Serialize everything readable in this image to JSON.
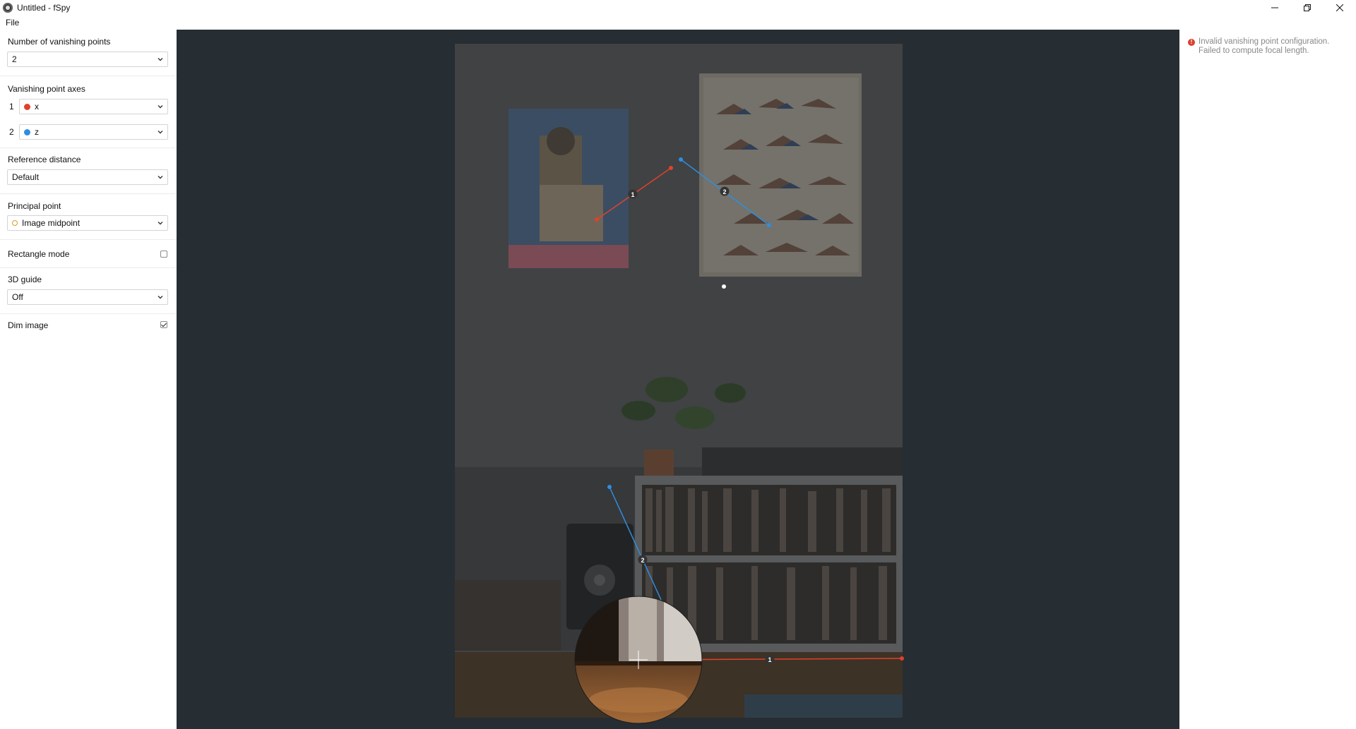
{
  "window": {
    "title": "Untitled - fSpy"
  },
  "menu": {
    "file": "File"
  },
  "settings": {
    "num_vp": {
      "label": "Number of vanishing points",
      "value": "2"
    },
    "vp_axes": {
      "label": "Vanishing point axes",
      "axis1": {
        "num": "1",
        "value": "x",
        "color": "#e0412b"
      },
      "axis2": {
        "num": "2",
        "value": "z",
        "color": "#2f8ee0"
      }
    },
    "reference_distance": {
      "label": "Reference distance",
      "value": "Default"
    },
    "principal_point": {
      "label": "Principal point",
      "value": "Image midpoint"
    },
    "rectangle_mode": {
      "label": "Rectangle mode",
      "checked": false
    },
    "guide_3d": {
      "label": "3D guide",
      "value": "Off"
    },
    "dim_image": {
      "label": "Dim image",
      "checked": true
    }
  },
  "overlay": {
    "handle_labels": [
      "1",
      "2",
      "2",
      "1"
    ]
  },
  "status": {
    "message": "Invalid vanishing point configuration.\nFailed to compute focal length.",
    "color": "#d9412f"
  }
}
